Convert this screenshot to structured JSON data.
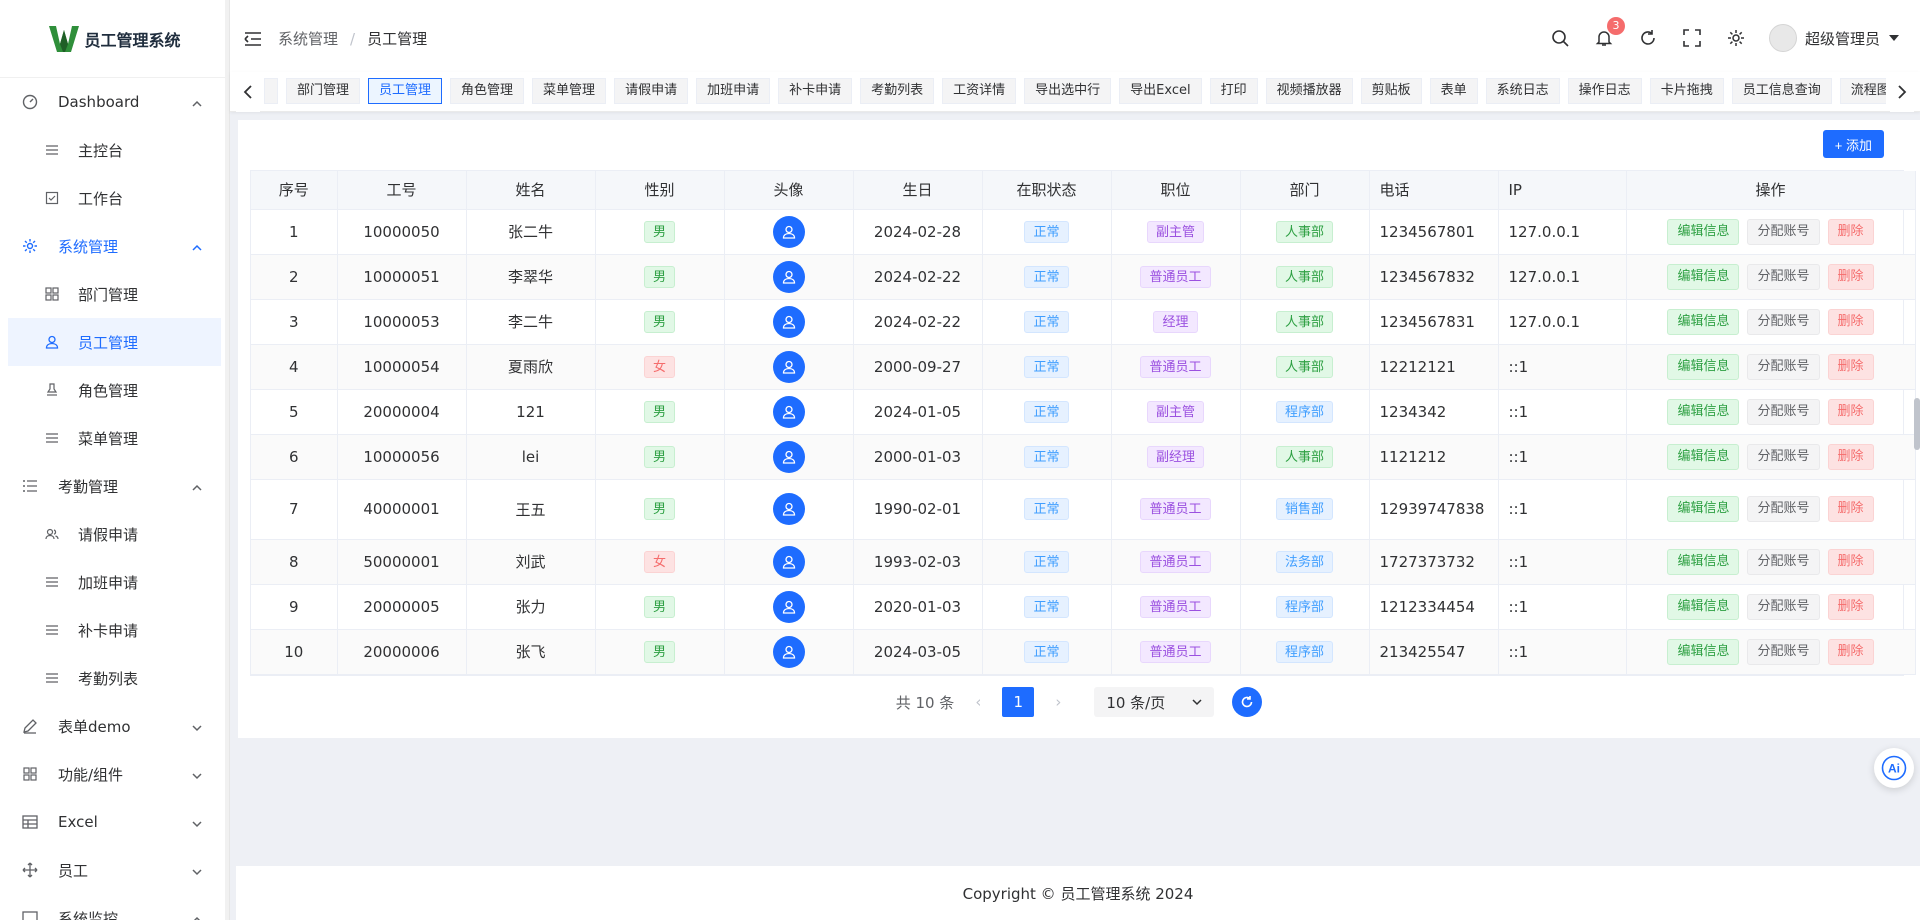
{
  "app": {
    "title": "员工管理系统"
  },
  "sidebar": {
    "items": [
      {
        "label": "Dashboard",
        "icon": "dashboard-icon",
        "level": 1,
        "expanded": true
      },
      {
        "label": "主控台",
        "icon": "list-icon",
        "level": 2
      },
      {
        "label": "工作台",
        "icon": "bookmark-icon",
        "level": 2
      },
      {
        "label": "系统管理",
        "icon": "gear-icon",
        "level": 1,
        "expanded": true,
        "highlight": true
      },
      {
        "label": "部门管理",
        "icon": "grid-icon",
        "level": 2
      },
      {
        "label": "员工管理",
        "icon": "user-icon",
        "level": 2,
        "active": true
      },
      {
        "label": "角色管理",
        "icon": "stamp-icon",
        "level": 2
      },
      {
        "label": "菜单管理",
        "icon": "list-icon",
        "level": 2
      },
      {
        "label": "考勤管理",
        "icon": "list-bullet-icon",
        "level": 1,
        "expanded": true
      },
      {
        "label": "请假申请",
        "icon": "users-icon",
        "level": 2
      },
      {
        "label": "加班申请",
        "icon": "list-icon",
        "level": 2
      },
      {
        "label": "补卡申请",
        "icon": "list-icon",
        "level": 2
      },
      {
        "label": "考勤列表",
        "icon": "list-icon",
        "level": 2
      },
      {
        "label": "表单demo",
        "icon": "edit-icon",
        "level": 1,
        "expanded": false
      },
      {
        "label": "功能/组件",
        "icon": "grid-icon",
        "level": 1,
        "expanded": false
      },
      {
        "label": "Excel",
        "icon": "table-icon",
        "level": 1,
        "expanded": false
      },
      {
        "label": "员工",
        "icon": "move-icon",
        "level": 1,
        "expanded": false
      },
      {
        "label": "系统监控",
        "icon": "monitor-icon",
        "level": 1,
        "expanded": true
      }
    ]
  },
  "header": {
    "breadcrumb": [
      "系统管理",
      "员工管理"
    ],
    "notification_count": "3",
    "user_name": "超级管理员"
  },
  "tags": {
    "items": [
      "部门管理",
      "员工管理",
      "角色管理",
      "菜单管理",
      "请假申请",
      "加班申请",
      "补卡申请",
      "考勤列表",
      "工资详情",
      "导出选中行",
      "导出Excel",
      "打印",
      "视频播放器",
      "剪贴板",
      "表单",
      "系统日志",
      "操作日志",
      "卡片拖拽",
      "员工信息查询",
      "流程图"
    ],
    "active": "员工管理"
  },
  "toolbar": {
    "add_label": "+ 添加"
  },
  "table": {
    "columns": [
      "序号",
      "工号",
      "姓名",
      "性别",
      "头像",
      "生日",
      "在职状态",
      "职位",
      "部门",
      "电话",
      "IP",
      "操作"
    ],
    "rows": [
      {
        "idx": "1",
        "no": "10000050",
        "name": "张二牛",
        "gender": "男",
        "birthday": "2024-02-28",
        "status": "正常",
        "position": "副主管",
        "dept": "人事部",
        "phone": "1234567801",
        "ip": "127.0.0.1"
      },
      {
        "idx": "2",
        "no": "10000051",
        "name": "李翠华",
        "gender": "男",
        "birthday": "2024-02-22",
        "status": "正常",
        "position": "普通员工",
        "dept": "人事部",
        "phone": "1234567832",
        "ip": "127.0.0.1"
      },
      {
        "idx": "3",
        "no": "10000053",
        "name": "李二牛",
        "gender": "男",
        "birthday": "2024-02-22",
        "status": "正常",
        "position": "经理",
        "dept": "人事部",
        "phone": "1234567831",
        "ip": "127.0.0.1"
      },
      {
        "idx": "4",
        "no": "10000054",
        "name": "夏雨欣",
        "gender": "女",
        "birthday": "2000-09-27",
        "status": "正常",
        "position": "普通员工",
        "dept": "人事部",
        "phone": "12212121",
        "ip": "::1"
      },
      {
        "idx": "5",
        "no": "20000004",
        "name": "121",
        "gender": "男",
        "birthday": "2024-01-05",
        "status": "正常",
        "position": "副主管",
        "dept": "程序部",
        "phone": "1234342",
        "ip": "::1"
      },
      {
        "idx": "6",
        "no": "10000056",
        "name": "lei",
        "gender": "男",
        "birthday": "2000-01-03",
        "status": "正常",
        "position": "副经理",
        "dept": "人事部",
        "phone": "1121212",
        "ip": "::1"
      },
      {
        "idx": "7",
        "no": "40000001",
        "name": "王五",
        "gender": "男",
        "birthday": "1990-02-01",
        "status": "正常",
        "position": "普通员工",
        "dept": "销售部",
        "phone": "12939747838",
        "ip": "::1"
      },
      {
        "idx": "8",
        "no": "50000001",
        "name": "刘武",
        "gender": "女",
        "birthday": "1993-02-03",
        "status": "正常",
        "position": "普通员工",
        "dept": "法务部",
        "phone": "1727373732",
        "ip": "::1"
      },
      {
        "idx": "9",
        "no": "20000005",
        "name": "张力",
        "gender": "男",
        "birthday": "2020-01-03",
        "status": "正常",
        "position": "普通员工",
        "dept": "程序部",
        "phone": "1212334454",
        "ip": "::1"
      },
      {
        "idx": "10",
        "no": "20000006",
        "name": "张飞",
        "gender": "男",
        "birthday": "2024-03-05",
        "status": "正常",
        "position": "普通员工",
        "dept": "程序部",
        "phone": "213425547",
        "ip": "::1"
      }
    ],
    "actions": {
      "edit": "编辑信息",
      "assign": "分配账号",
      "delete": "删除"
    }
  },
  "pagination": {
    "total_text": "共 10 条",
    "current_page": "1",
    "page_size": "10 条/页"
  },
  "footer": {
    "copyright": "Copyright © 员工管理系统 2024"
  },
  "colors": {
    "primary": "#1e6cff",
    "success": "#2ea043",
    "danger": "#f56c6c",
    "purple": "#9b51e0"
  }
}
